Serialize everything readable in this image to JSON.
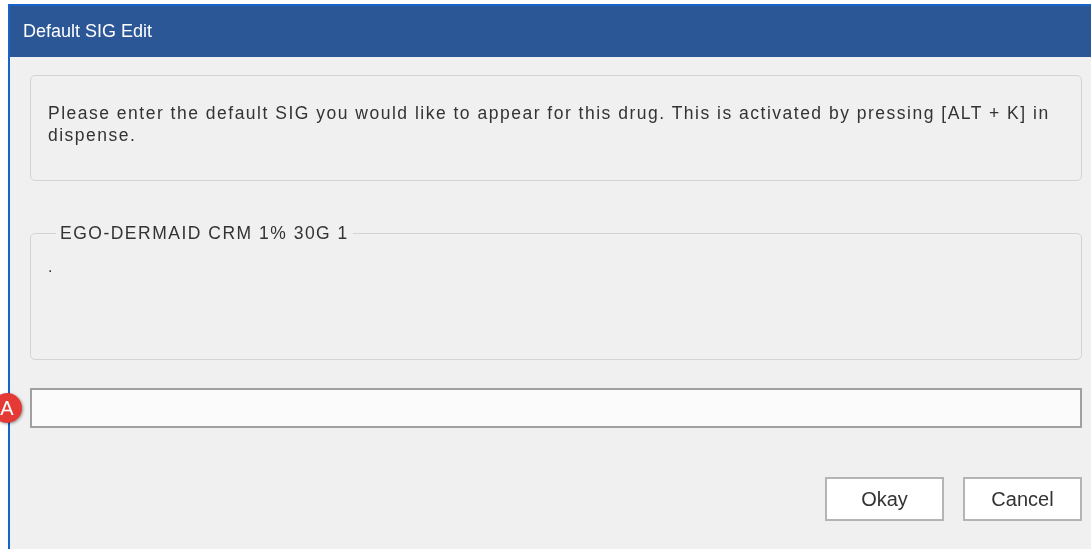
{
  "window": {
    "title": "Default SIG Edit"
  },
  "instructions": "Please enter the default SIG you would like to appear for this drug. This is activated by pressing [ALT + K] in dispense.",
  "drug_group": {
    "legend": "EGO-DERMAID CRM 1% 30G 1",
    "text": "."
  },
  "sig_field": {
    "marker": "A"
  },
  "buttons": [
    {
      "label": "Okay"
    },
    {
      "label": "Cancel"
    }
  ]
}
